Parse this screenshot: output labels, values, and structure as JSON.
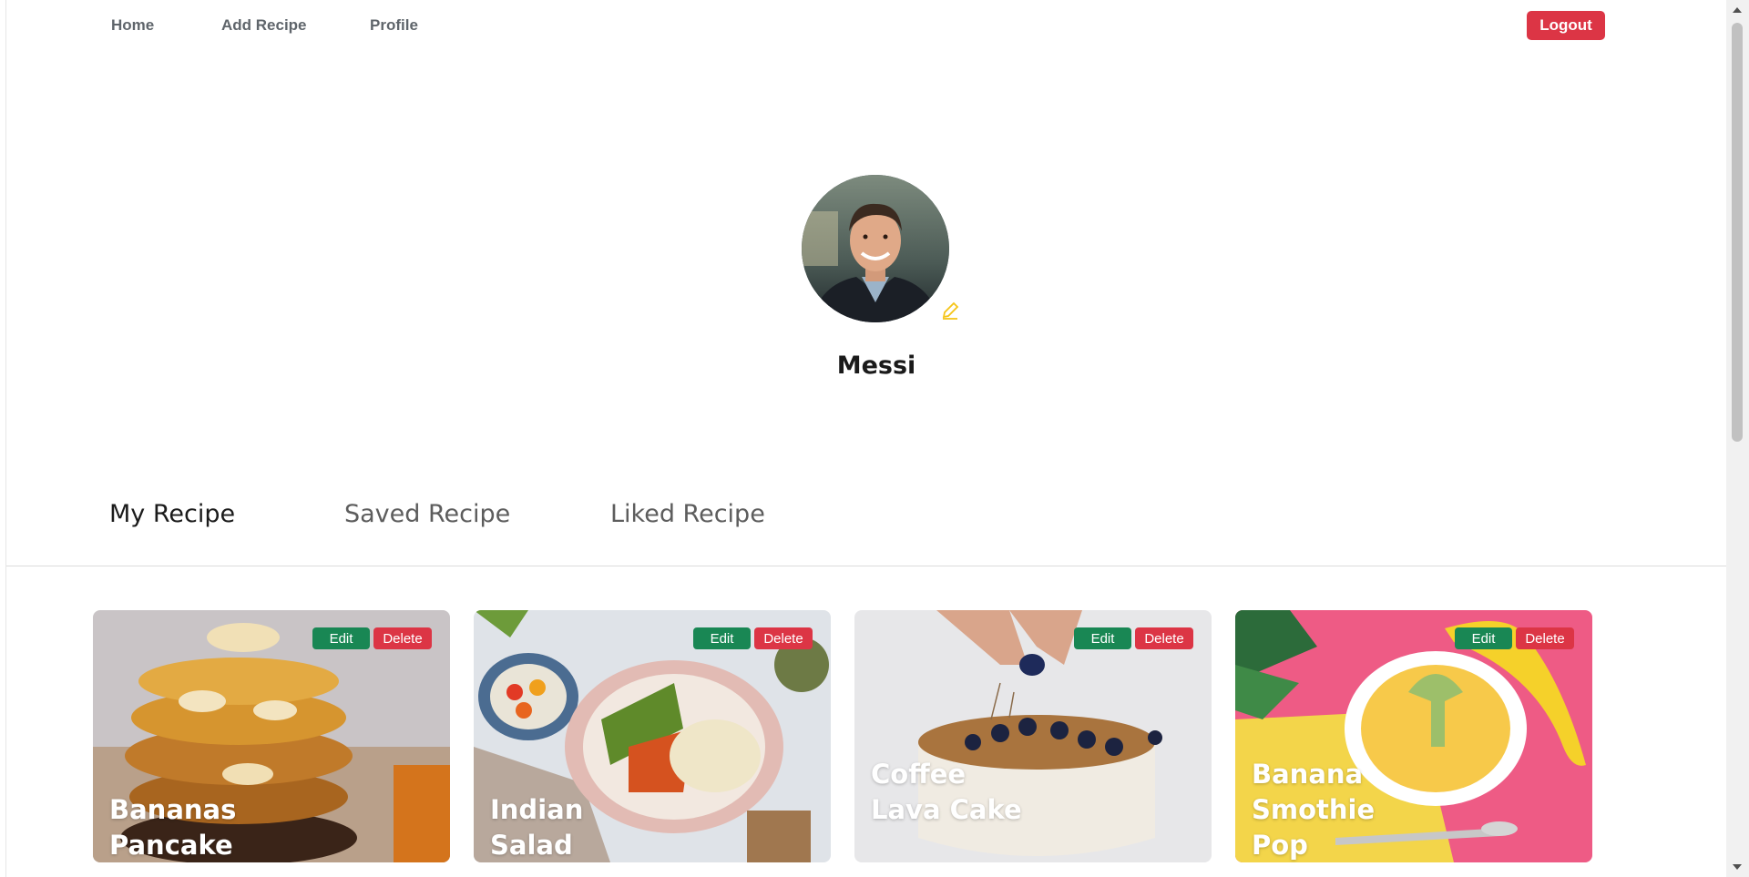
{
  "nav": {
    "home": "Home",
    "add_recipe": "Add Recipe",
    "profile": "Profile",
    "logout": "Logout"
  },
  "profile": {
    "username": "Messi"
  },
  "tabs": [
    {
      "label": "My Recipe",
      "active": true
    },
    {
      "label": "Saved Recipe",
      "active": false
    },
    {
      "label": "Liked Recipe",
      "active": false
    }
  ],
  "cards": [
    {
      "title": "Bananas Pancake",
      "edit": "Edit",
      "delete": "Delete"
    },
    {
      "title": "Indian Salad",
      "edit": "Edit",
      "delete": "Delete"
    },
    {
      "title": "Coffee Lava Cake",
      "edit": "Edit",
      "delete": "Delete"
    },
    {
      "title": "Banana Smothie Pop",
      "edit": "Edit",
      "delete": "Delete"
    }
  ],
  "colors": {
    "danger": "#dc3545",
    "success": "#198754",
    "edit_icon": "#f5c518"
  },
  "icons": {
    "edit_avatar": "pencil-icon"
  }
}
